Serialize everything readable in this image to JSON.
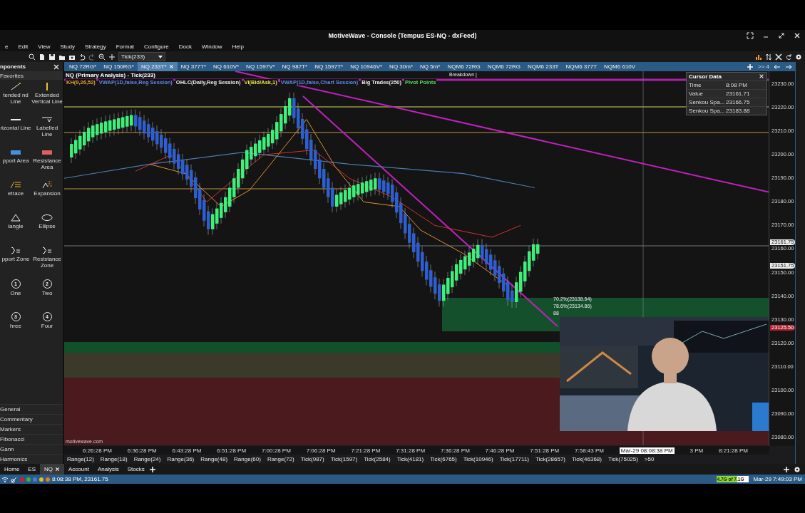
{
  "window": {
    "title": "MotiveWave - Console (Tempus ES-NQ - dxFeed)"
  },
  "menu": [
    "e",
    "Edit",
    "View",
    "Study",
    "Strategy",
    "Format",
    "Configure",
    "Dock",
    "Window",
    "Help"
  ],
  "toolbar": {
    "bar_size": "Tick(233)"
  },
  "components": {
    "title": "nponents",
    "section": "Favorites",
    "tools": [
      {
        "label": "tended nd Line",
        "kind": "trend"
      },
      {
        "label": "Extended Vertical Line",
        "kind": "vline"
      },
      {
        "label": "rizontal Line",
        "kind": "hline"
      },
      {
        "label": "Labelled Line",
        "kind": "labelled"
      },
      {
        "label": "pport Area",
        "kind": "support"
      },
      {
        "label": "Resistance Area",
        "kind": "resistance"
      },
      {
        "label": "etrace",
        "kind": "retrace"
      },
      {
        "label": "Expansion",
        "kind": "expansion"
      },
      {
        "label": "iangle",
        "kind": "triangle"
      },
      {
        "label": "Ellipse",
        "kind": "ellipse"
      },
      {
        "label": "pport Zone",
        "kind": "zone"
      },
      {
        "label": "Resistance Zone",
        "kind": "zone"
      },
      {
        "label": "One",
        "kind": "number",
        "glyph": "1"
      },
      {
        "label": "Two",
        "kind": "number",
        "glyph": "2"
      },
      {
        "label": "hree",
        "kind": "number",
        "glyph": "3"
      },
      {
        "label": "Four",
        "kind": "number",
        "glyph": "4"
      }
    ],
    "categories": [
      "General",
      "Commentary",
      "Markers",
      "Fibonacci",
      "Gann",
      "Harmonics"
    ]
  },
  "chart_tabs": [
    {
      "label": "NQ 72RG*",
      "selected": false
    },
    {
      "label": "NQ 150RG*",
      "selected": false
    },
    {
      "label": "NQ 233T*",
      "selected": true
    },
    {
      "label": "NQ 377T*",
      "selected": false
    },
    {
      "label": "NQ 610V*",
      "selected": false
    },
    {
      "label": "NQ 1597V*",
      "selected": false
    },
    {
      "label": "NQ 987T*",
      "selected": false
    },
    {
      "label": "NQ 1597T*",
      "selected": false
    },
    {
      "label": "NQ 10946V*",
      "selected": false
    },
    {
      "label": "NQ 30m*",
      "selected": false
    },
    {
      "label": "NQ 5m*",
      "selected": false
    },
    {
      "label": "NQM6 72RG",
      "selected": false
    },
    {
      "label": "NQM6 72RG",
      "selected": false
    },
    {
      "label": "NQM6 233T",
      "selected": false
    },
    {
      "label": "NQM6 377T",
      "selected": false
    },
    {
      "label": "NQM6 610V",
      "selected": false
    }
  ],
  "more_tabs": ">> 4",
  "chart": {
    "title": "NQ (Primary Analysis) - Tick(233)",
    "studies": [
      {
        "label": "KH(9,26,52)",
        "color": "#e0a030"
      },
      {
        "label": "VWAP(1D,false,Reg Session)",
        "color": "#5a8ae8"
      },
      {
        "label": "OHLC(Daily,Reg Session)",
        "color": "#e8e8e8"
      },
      {
        "label": "VI(Bid/Ask,1)",
        "color": "#e8e040"
      },
      {
        "label": "VWAP(1D,false,Chart Session)",
        "color": "#5a8ae8"
      },
      {
        "label": "Big Trades(250)",
        "color": "#e8e8e8"
      },
      {
        "label": "Pivot Points",
        "color": "#50e050"
      }
    ],
    "annotation": "Breakdown |",
    "fib_labels": [
      "70.2%(23138.54)",
      "78.6%(23134.86)",
      "88"
    ],
    "watermark": "motivewave.com",
    "cursor_data": {
      "title": "Cursor Data",
      "rows": [
        {
          "label": "Time",
          "value": "8:08 PM"
        },
        {
          "label": "Value",
          "value": "23161.71"
        },
        {
          "label": "Senkou Spa...",
          "value": "23166.75"
        },
        {
          "label": "Senkou Spa...",
          "value": "23183.88"
        }
      ]
    },
    "price_ticks": [
      "23230.00",
      "23220.00",
      "23210.00",
      "23200.00",
      "23190.00",
      "23180.00",
      "23170.00",
      "23160.00",
      "23150.00",
      "23140.00",
      "23130.00",
      "23120.00",
      "23110.00",
      "23100.00",
      "23090.00",
      "23080.00"
    ],
    "price_markers": [
      {
        "label": "23161.75",
        "kind": "last"
      },
      {
        "label": "23151.75",
        "kind": "last"
      },
      {
        "label": "23125.50",
        "kind": "alert"
      }
    ],
    "time_labels": [
      {
        "label": "6:26:28 PM",
        "kind": "tick"
      },
      {
        "label": "6:36:28 PM",
        "kind": "tick"
      },
      {
        "label": "6:43:28 PM",
        "kind": "tick"
      },
      {
        "label": "6:51:28 PM",
        "kind": "tick"
      },
      {
        "label": "7:00:28 PM",
        "kind": "tick"
      },
      {
        "label": "7:06:28 PM",
        "kind": "tick"
      },
      {
        "label": "7:21:28 PM",
        "kind": "tick"
      },
      {
        "label": "7:31:28 PM",
        "kind": "tick"
      },
      {
        "label": "7:36:28 PM",
        "kind": "tick"
      },
      {
        "label": "7:46:28 PM",
        "kind": "tick"
      },
      {
        "label": "7:51:28 PM",
        "kind": "tick"
      },
      {
        "label": "7:58:43 PM",
        "kind": "tick"
      },
      {
        "label": "Mar-29 08:08:38 PM",
        "kind": "crosshair"
      },
      {
        "label": "3 PM",
        "kind": "tick"
      },
      {
        "label": "8:21:28 PM",
        "kind": "tick"
      }
    ]
  },
  "bar_types": [
    "Range(12)",
    "Range(18)",
    "Range(24)",
    "Range(36)",
    "Range(48)",
    "Range(60)",
    "Range(72)",
    "Tick(987)",
    "Tick(1597)",
    "Tick(2584)",
    "Tick(4181)",
    "Tick(6765)",
    "Tick(10946)",
    "Tick(17711)",
    "Tick(28657)",
    "Tick(46368)",
    "Tick(75025)"
  ],
  "more_bar_types": ">50",
  "workspace_tabs": [
    {
      "label": "Home",
      "selected": false
    },
    {
      "label": "ES",
      "selected": false
    },
    {
      "label": "NQ",
      "selected": true
    },
    {
      "label": "Account",
      "selected": false
    },
    {
      "label": "Analysis",
      "selected": false
    },
    {
      "label": "Stocks",
      "selected": false
    }
  ],
  "status_bar": {
    "lights": [
      {
        "color": "#d0202a"
      },
      {
        "color": "#40b040"
      },
      {
        "color": "#4a7ae0"
      },
      {
        "color": "#e0c020"
      },
      {
        "color": "#e08020"
      }
    ],
    "reading": "8:08:38 PM, 23161.75",
    "memory": {
      "label": "4.7G of 7.1G",
      "level": 0.66
    },
    "clock": "Mar-29 7:49:03 PM"
  }
}
